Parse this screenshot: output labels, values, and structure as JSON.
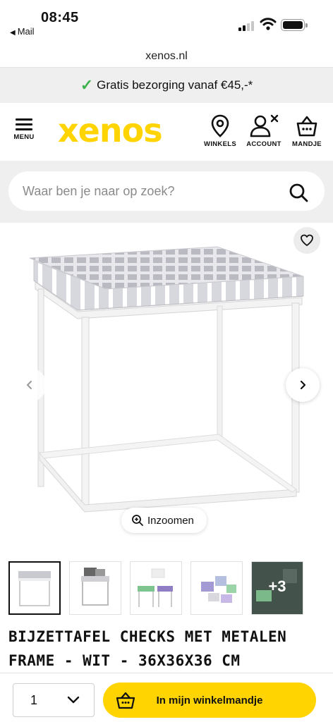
{
  "status_bar": {
    "time": "08:45",
    "back_app": "Mail"
  },
  "browser": {
    "url": "xenos.nl"
  },
  "promo": {
    "text": "Gratis bezorging vanaf €45,-*",
    "check_color": "#3fb34f"
  },
  "header": {
    "logo": "xenos",
    "logo_color": "#ffd400",
    "menu_label": "MENU",
    "nav": [
      {
        "label": "WINKELS",
        "icon": "location-pin-icon"
      },
      {
        "label": "ACCOUNT",
        "icon": "account-icon"
      },
      {
        "label": "MANDJE",
        "icon": "basket-icon"
      }
    ]
  },
  "search": {
    "placeholder": "Waar ben je naar op zoek?"
  },
  "gallery": {
    "zoom_label": "Inzoomen",
    "thumbnails": [
      {
        "name": "thumbnail-1",
        "active": true
      },
      {
        "name": "thumbnail-2",
        "active": false
      },
      {
        "name": "thumbnail-3",
        "active": false
      },
      {
        "name": "thumbnail-4",
        "active": false
      },
      {
        "name": "thumbnail-more",
        "active": false,
        "label": "+3"
      }
    ]
  },
  "product": {
    "title_line1": "BIJZETTAFEL CHECKS MET METALEN",
    "title_line2": "FRAME - WIT - 36X36X36 CM"
  },
  "cart_bar": {
    "quantity": "1",
    "add_to_cart_label": "In mijn winkelmandje",
    "button_color": "#ffd400"
  }
}
